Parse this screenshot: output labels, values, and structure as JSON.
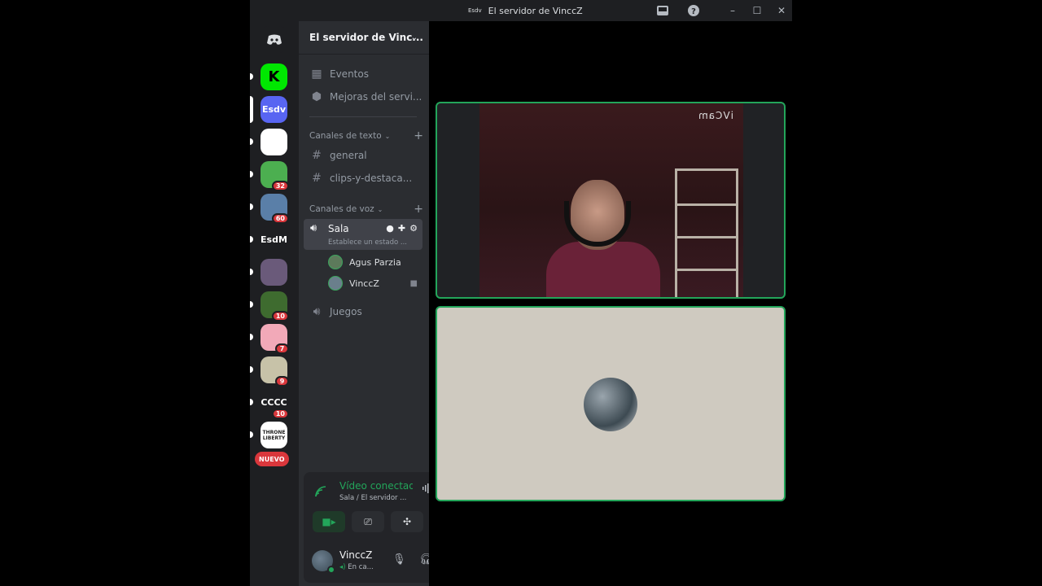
{
  "window": {
    "server_mini": "Esdv",
    "title": "El servidor de VinccZ"
  },
  "rail": {
    "servers": [
      {
        "label": "K",
        "color": "#00e701",
        "badge": null
      },
      {
        "label": "Esdv",
        "color": "#5865f2",
        "badge": null,
        "active": true
      },
      {
        "label": "",
        "color": "#ffffff",
        "badge": null
      },
      {
        "label": "",
        "color": "#4caf50",
        "badge": "32"
      },
      {
        "label": "",
        "color": "#5a7fa8",
        "badge": "60"
      },
      {
        "label": "EsdM",
        "color": "#1e1f22",
        "badge": null
      },
      {
        "label": "",
        "color": "#6a5a7a",
        "badge": null
      },
      {
        "label": "",
        "color": "#3e6b2f",
        "badge": "10"
      },
      {
        "label": "",
        "color": "#f2a9b8",
        "badge": "7"
      },
      {
        "label": "",
        "color": "#c7c2a8",
        "badge": "9"
      },
      {
        "label": "CCCC",
        "color": "#1e1f22",
        "badge": "10"
      },
      {
        "label": "THRONE LIBERTY",
        "color": "#ffffff",
        "badge": null
      }
    ],
    "new_label": "NUEVO"
  },
  "panel": {
    "server_name": "El servidor de Vinc...",
    "events": "Eventos",
    "boosts": "Mejoras del servi...",
    "text_category": "Canales de texto",
    "text_channels": [
      "general",
      "clips-y-destaca..."
    ],
    "voice_category": "Canales de voz",
    "active_voice": {
      "name": "Sala",
      "status": "Establece un estado ..."
    },
    "voice_users": [
      "Agus Parzia",
      "VinccZ"
    ],
    "other_voice": "Juegos"
  },
  "voice_status": {
    "title": "Vídeo conectado",
    "subtitle": "Sala / El servidor ..."
  },
  "user": {
    "name": "VinccZ",
    "status": "En ca..."
  },
  "stage": {
    "watermark": "iVCam"
  },
  "colors": {
    "accent_green": "#23a55a",
    "badge_red": "#da373c",
    "bg_dark": "#1e1f22",
    "panel": "#2b2d31"
  }
}
